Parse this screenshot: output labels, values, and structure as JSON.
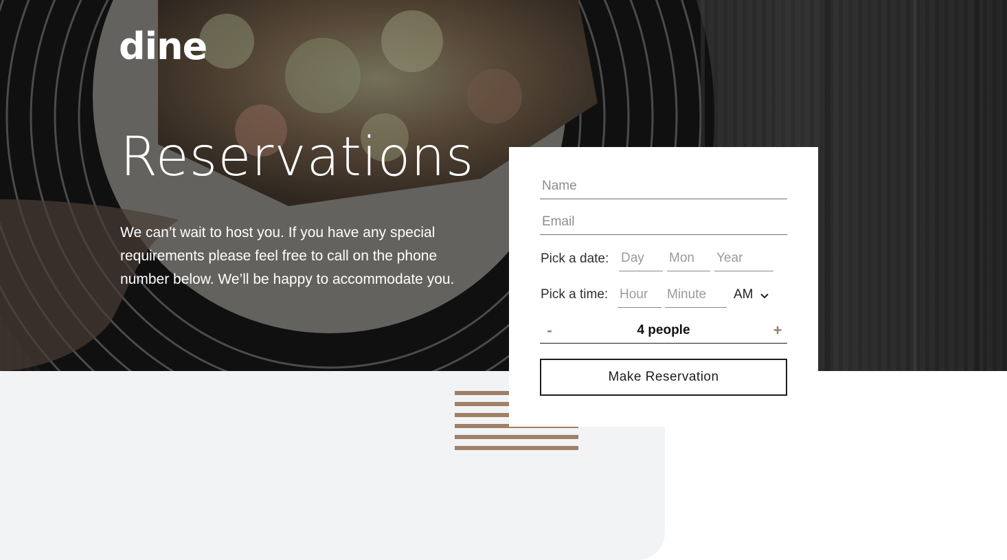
{
  "brand": {
    "logo": "dine"
  },
  "hero": {
    "title": "Reservations",
    "intro": "We can’t wait to host you. If you have any special requirements please feel free to call on the phone number below. We’ll be happy to accommodate you."
  },
  "form": {
    "name_placeholder": "Name",
    "email_placeholder": "Email",
    "date_label": "Pick a date:",
    "day_placeholder": "Day",
    "month_placeholder": "Mon",
    "year_placeholder": "Year",
    "time_label": "Pick a time:",
    "hour_placeholder": "Hour",
    "minute_placeholder": "Minute",
    "period_value": "AM",
    "people_decrement": "-",
    "people_value": "4 people",
    "people_increment": "+",
    "submit_label": "Make Reservation"
  },
  "colors": {
    "accent": "#9f7f66",
    "panel": "#f2f3f5",
    "dark": "#1d1d1d"
  },
  "icons": [
    "chevron-down-icon",
    "stripes-decoration"
  ]
}
